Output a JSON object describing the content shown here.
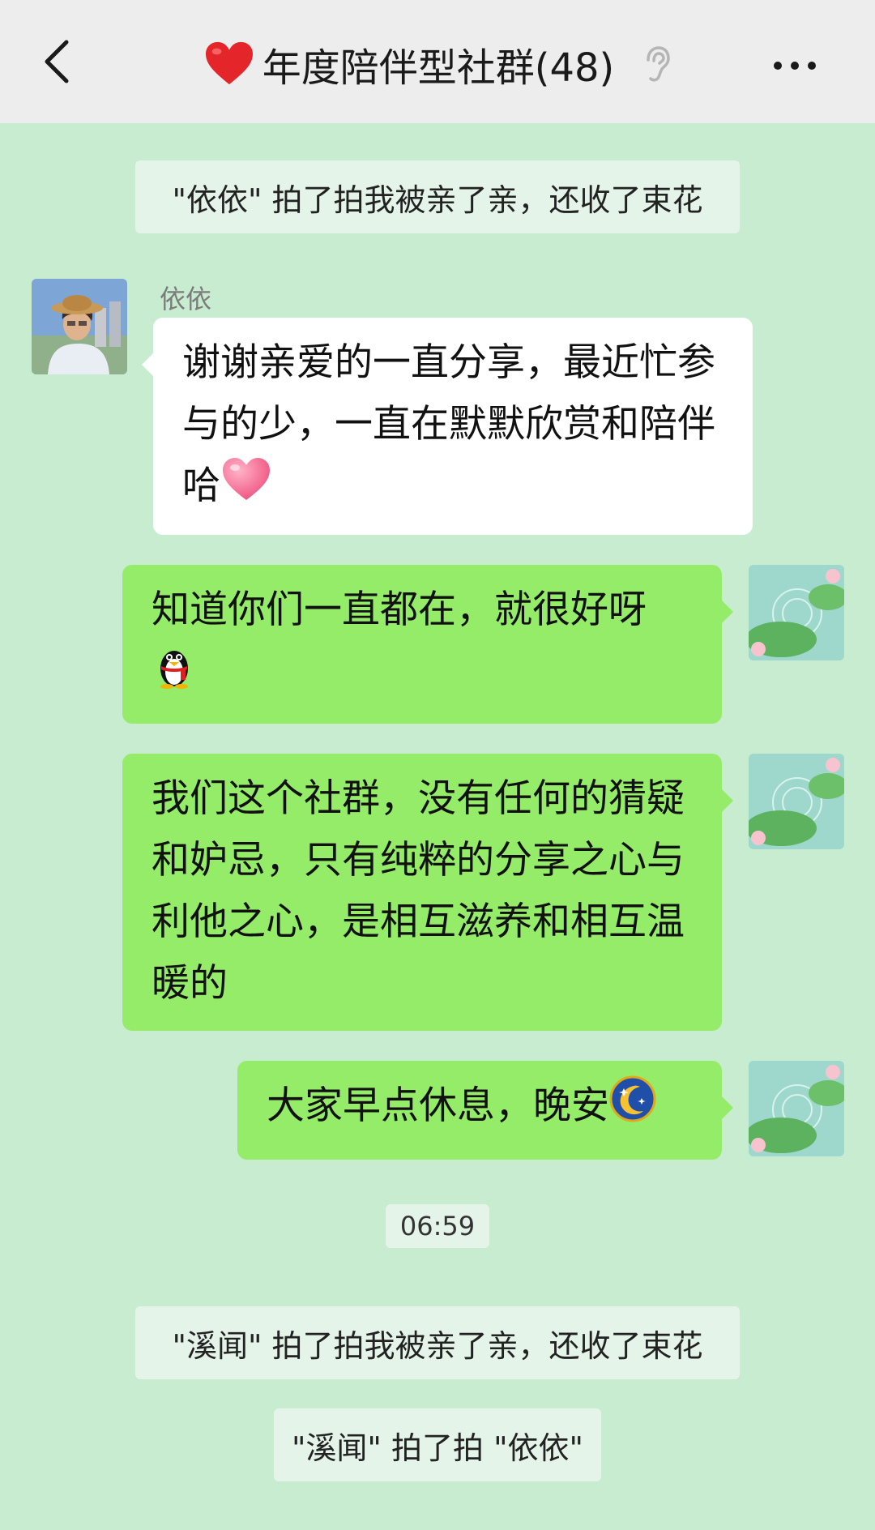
{
  "header": {
    "title": "年度陪伴型社群(48)",
    "back_icon": "chevron-left-icon",
    "more_icon": "more-dots-icon",
    "ear_icon": "ear-icon",
    "title_icon": "red-heart-icon"
  },
  "messages": {
    "sys1": "\"依依\" 拍了拍我被亲了亲，还收了束花",
    "m1_sender": "依依",
    "m1_text": "谢谢亲爱的一直分享，最近忙参与的少，一直在默默欣赏和陪伴哈",
    "m1_emoji": "pink-heart-icon",
    "m2_text": "知道你们一直都在，就很好呀",
    "m2_emoji": "qq-penguin-icon",
    "m3_text": "我们这个社群，没有任何的猜疑和妒忌，只有纯粹的分享之心与利他之心，是相互滋养和相互温暖的",
    "m4_text": "大家早点休息，晚安",
    "m4_emoji": "moon-stars-icon",
    "time": "06:59",
    "sys2": "\"溪闻\" 拍了拍我被亲了亲，还收了束花",
    "sys3": "\"溪闻\" 拍了拍 \"依依\""
  },
  "colors": {
    "chat_background": "#c7ecd0",
    "header_background": "#ededed",
    "own_bubble": "#95ec69",
    "other_bubble": "#ffffff",
    "system_message_bg": "#e4f4e8"
  }
}
